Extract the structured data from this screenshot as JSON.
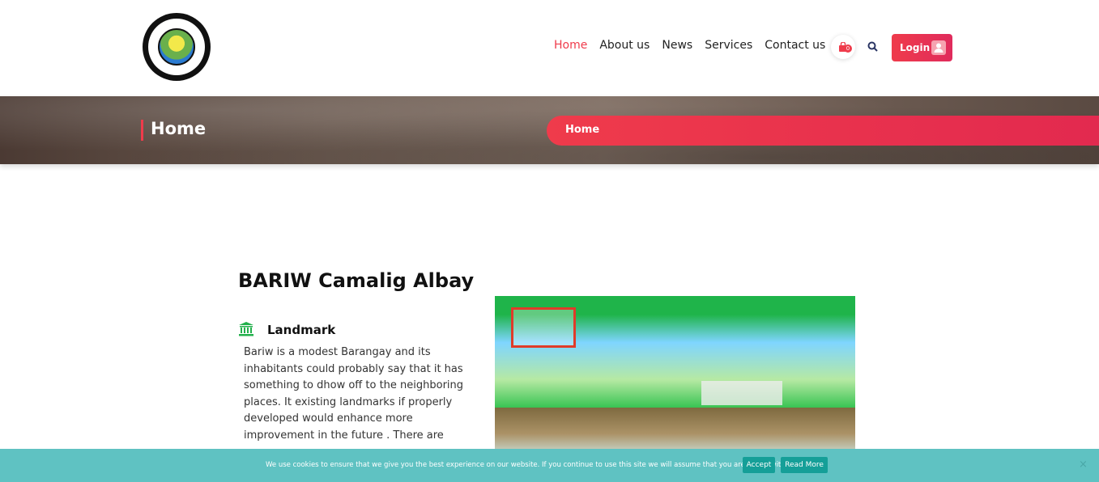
{
  "nav": {
    "items": [
      "Home",
      "About us",
      "News",
      "Services",
      "Contact us"
    ],
    "cart_count": "0",
    "login_label": "Login"
  },
  "banner": {
    "title": "Home",
    "breadcrumb": "Home"
  },
  "main": {
    "heading": "BARIW Camalig Albay",
    "landmark_title": "Landmark",
    "landmark_text": "Bariw is a modest Barangay and its inhabitants could probably say that it has something to dhow off to the neighboring places. It existing landmarks if properly developed would enhance more improvement in the future . There are"
  },
  "cookie": {
    "text": "We use cookies to ensure that we give you the best experience on our website. If you continue to use this site we will assume that you are happy with it.",
    "accept": "Accept",
    "read_more": "Read More",
    "close": "×"
  },
  "colors": {
    "accent": "#ef3b4b",
    "cookie_bg": "#5fc2c2",
    "cookie_btn": "#159f98"
  }
}
